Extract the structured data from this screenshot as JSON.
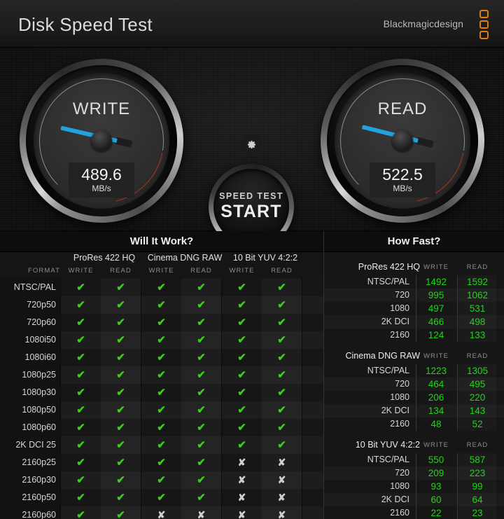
{
  "window": {
    "close_label": "✕"
  },
  "header": {
    "title": "Disk Speed Test",
    "brand": "Blackmagicdesign",
    "brand_color": "#e07b18"
  },
  "gauges": {
    "write": {
      "label": "WRITE",
      "value": "489.6",
      "unit": "MB/s",
      "needle_angle": 193,
      "needle_color": "#22a3e0"
    },
    "read": {
      "label": "READ",
      "value": "522.5",
      "unit": "MB/s",
      "needle_angle": 194,
      "needle_color": "#22a3e0"
    }
  },
  "controls": {
    "gear_icon": "gear-icon",
    "start_top": "SPEED TEST",
    "start_main": "START"
  },
  "will_it_work": {
    "title": "Will It Work?",
    "format_header": "FORMAT",
    "codecs": [
      "ProRes 422 HQ",
      "Cinema DNG RAW",
      "10 Bit YUV 4:2:2"
    ],
    "sub_headers": [
      "WRITE",
      "READ"
    ],
    "ok_glyph": "✔",
    "fail_glyph": "✘",
    "ok_color": "#3ecc1f",
    "fail_color": "#cfcfcf",
    "rows": [
      {
        "format": "NTSC/PAL",
        "cells": [
          true,
          true,
          true,
          true,
          true,
          true
        ]
      },
      {
        "format": "720p50",
        "cells": [
          true,
          true,
          true,
          true,
          true,
          true
        ]
      },
      {
        "format": "720p60",
        "cells": [
          true,
          true,
          true,
          true,
          true,
          true
        ]
      },
      {
        "format": "1080i50",
        "cells": [
          true,
          true,
          true,
          true,
          true,
          true
        ]
      },
      {
        "format": "1080i60",
        "cells": [
          true,
          true,
          true,
          true,
          true,
          true
        ]
      },
      {
        "format": "1080p25",
        "cells": [
          true,
          true,
          true,
          true,
          true,
          true
        ]
      },
      {
        "format": "1080p30",
        "cells": [
          true,
          true,
          true,
          true,
          true,
          true
        ]
      },
      {
        "format": "1080p50",
        "cells": [
          true,
          true,
          true,
          true,
          true,
          true
        ]
      },
      {
        "format": "1080p60",
        "cells": [
          true,
          true,
          true,
          true,
          true,
          true
        ]
      },
      {
        "format": "2K DCI 25",
        "cells": [
          true,
          true,
          true,
          true,
          true,
          true
        ]
      },
      {
        "format": "2160p25",
        "cells": [
          true,
          true,
          true,
          true,
          false,
          false
        ]
      },
      {
        "format": "2160p30",
        "cells": [
          true,
          true,
          true,
          true,
          false,
          false
        ]
      },
      {
        "format": "2160p50",
        "cells": [
          true,
          true,
          true,
          true,
          false,
          false
        ]
      },
      {
        "format": "2160p60",
        "cells": [
          true,
          true,
          false,
          false,
          false,
          false
        ]
      }
    ]
  },
  "how_fast": {
    "title": "How Fast?",
    "write_header": "WRITE",
    "read_header": "READ",
    "value_color": "#22d417",
    "groups": [
      {
        "name": "ProRes 422 HQ",
        "rows": [
          {
            "label": "NTSC/PAL",
            "write": "1492",
            "read": "1592"
          },
          {
            "label": "720",
            "write": "995",
            "read": "1062"
          },
          {
            "label": "1080",
            "write": "497",
            "read": "531"
          },
          {
            "label": "2K DCI",
            "write": "466",
            "read": "498"
          },
          {
            "label": "2160",
            "write": "124",
            "read": "133"
          }
        ]
      },
      {
        "name": "Cinema DNG RAW",
        "rows": [
          {
            "label": "NTSC/PAL",
            "write": "1223",
            "read": "1305"
          },
          {
            "label": "720",
            "write": "464",
            "read": "495"
          },
          {
            "label": "1080",
            "write": "206",
            "read": "220"
          },
          {
            "label": "2K DCI",
            "write": "134",
            "read": "143"
          },
          {
            "label": "2160",
            "write": "48",
            "read": "52"
          }
        ]
      },
      {
        "name": "10 Bit YUV 4:2:2",
        "rows": [
          {
            "label": "NTSC/PAL",
            "write": "550",
            "read": "587"
          },
          {
            "label": "720",
            "write": "209",
            "read": "223"
          },
          {
            "label": "1080",
            "write": "93",
            "read": "99"
          },
          {
            "label": "2K DCI",
            "write": "60",
            "read": "64"
          },
          {
            "label": "2160",
            "write": "22",
            "read": "23"
          }
        ]
      }
    ]
  }
}
